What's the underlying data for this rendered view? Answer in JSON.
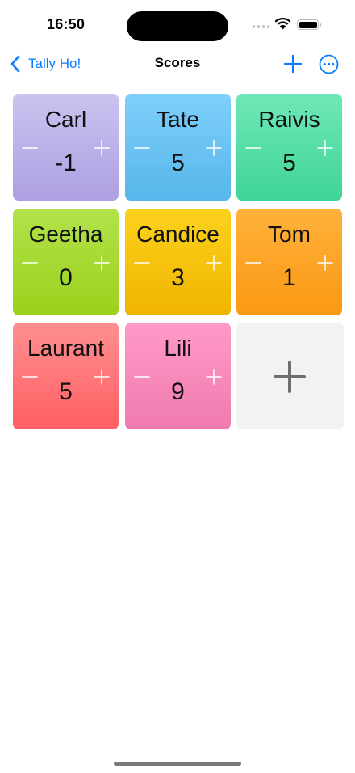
{
  "status_bar": {
    "time": "16:50",
    "icons": [
      "cellular-signal-icon",
      "wifi-icon",
      "battery-icon"
    ]
  },
  "nav": {
    "back_label": "Tally Ho!",
    "title": "Scores",
    "icons": [
      "chevron-left-icon",
      "plus-icon",
      "ellipsis-circle-icon"
    ],
    "accent_color": "#0a7aff"
  },
  "players": [
    {
      "name": "Carl",
      "score": "-1",
      "color_top": "#cac4f0",
      "color_bottom": "#ad9fe1"
    },
    {
      "name": "Tate",
      "score": "5",
      "color_top": "#7fd0fb",
      "color_bottom": "#57b6ea"
    },
    {
      "name": "Raivis",
      "score": "5",
      "color_top": "#6fe8b8",
      "color_bottom": "#3fd497"
    },
    {
      "name": "Geetha",
      "score": "0",
      "color_top": "#b2e24b",
      "color_bottom": "#9bd11c"
    },
    {
      "name": "Candice",
      "score": "3",
      "color_top": "#fcd21c",
      "color_bottom": "#f0b400"
    },
    {
      "name": "Tom",
      "score": "1",
      "color_top": "#ffb13c",
      "color_bottom": "#fb9812"
    },
    {
      "name": "Laurant",
      "score": "5",
      "color_top": "#ff8f8f",
      "color_bottom": "#ff5f64"
    },
    {
      "name": "Lili",
      "score": "9",
      "color_top": "#ff9ac8",
      "color_bottom": "#f07aae"
    }
  ],
  "add_tile": {
    "icon": "plus-icon"
  }
}
